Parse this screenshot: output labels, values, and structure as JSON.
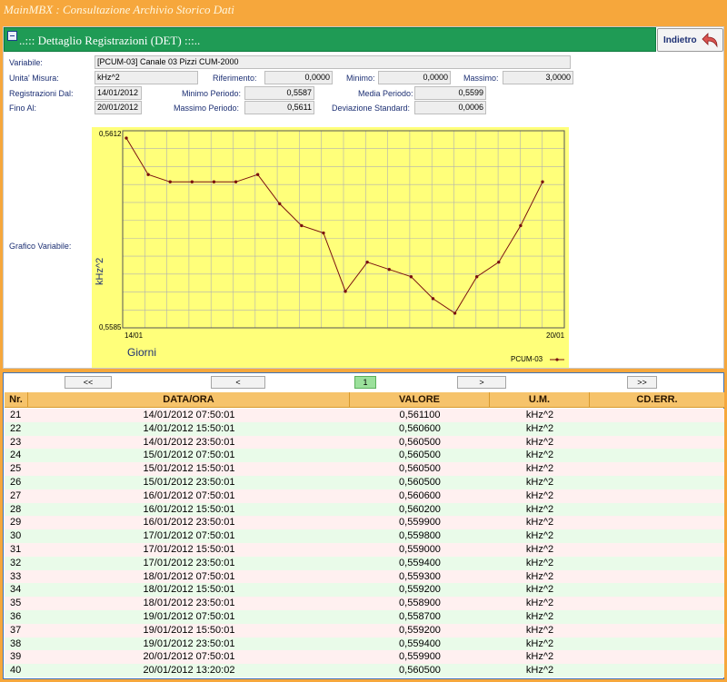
{
  "app": {
    "title": "MainMBX : Consultazione Archivio Storico Dati"
  },
  "panel": {
    "title": "..:::  Dettaglio Registrazioni (DET) :::..",
    "back_label": "Indietro"
  },
  "form": {
    "variabile_label": "Variabile:",
    "variabile_value": "[PCUM-03] Canale 03 Pizzi CUM-2000",
    "unita_label": "Unita' Misura:",
    "unita_value": "kHz^2",
    "riferimento_label": "Riferimento:",
    "riferimento_value": "0,0000",
    "minimo_label": "Minimo:",
    "minimo_value": "0,0000",
    "massimo_label": "Massimo:",
    "massimo_value": "3,0000",
    "reg_dal_label": "Registrazioni Dal:",
    "reg_dal_value": "14/01/2012",
    "min_periodo_label": "Minimo Periodo:",
    "min_periodo_value": "0,5587",
    "media_periodo_label": "Media Periodo:",
    "media_periodo_value": "0,5599",
    "fino_al_label": "Fino Al:",
    "fino_al_value": "20/01/2012",
    "max_periodo_label": "Massimo Periodo:",
    "max_periodo_value": "0,5611",
    "dev_std_label": "Deviazione Standard:",
    "dev_std_value": "0,0006",
    "grafico_label": "Grafico Variabile:"
  },
  "chart_data": {
    "type": "line",
    "title": "",
    "xlabel": "Giorni",
    "ylabel": "kHz^2",
    "ylim": [
      0.5585,
      0.5612
    ],
    "y_tick_labels": [
      "0,5612",
      "0,5585"
    ],
    "x_tick_labels": [
      "14/01",
      "20/01"
    ],
    "grid": true,
    "legend_position": "bottom-right",
    "colors": {
      "background": "#ffff7a",
      "grid": "#b0b0b0",
      "line": "#7a1010"
    },
    "series": [
      {
        "name": "PCUM-03",
        "values": [
          0.5611,
          0.5606,
          0.5605,
          0.5605,
          0.5605,
          0.5605,
          0.5606,
          0.5602,
          0.5599,
          0.5598,
          0.559,
          0.5594,
          0.5593,
          0.5592,
          0.5589,
          0.5587,
          0.5592,
          0.5594,
          0.5599,
          0.5605
        ]
      }
    ]
  },
  "pager": {
    "first": "<<",
    "prev": "<",
    "page": "1",
    "next": ">",
    "last": ">>"
  },
  "table": {
    "headers": [
      "Nr.",
      "DATA/ORA",
      "VALORE",
      "U.M.",
      "CD.ERR."
    ],
    "rows": [
      [
        "21",
        "14/01/2012 07:50:01",
        "0,561100",
        "kHz^2",
        ""
      ],
      [
        "22",
        "14/01/2012 15:50:01",
        "0,560600",
        "kHz^2",
        ""
      ],
      [
        "23",
        "14/01/2012 23:50:01",
        "0,560500",
        "kHz^2",
        ""
      ],
      [
        "24",
        "15/01/2012 07:50:01",
        "0,560500",
        "kHz^2",
        ""
      ],
      [
        "25",
        "15/01/2012 15:50:01",
        "0,560500",
        "kHz^2",
        ""
      ],
      [
        "26",
        "15/01/2012 23:50:01",
        "0,560500",
        "kHz^2",
        ""
      ],
      [
        "27",
        "16/01/2012 07:50:01",
        "0,560600",
        "kHz^2",
        ""
      ],
      [
        "28",
        "16/01/2012 15:50:01",
        "0,560200",
        "kHz^2",
        ""
      ],
      [
        "29",
        "16/01/2012 23:50:01",
        "0,559900",
        "kHz^2",
        ""
      ],
      [
        "30",
        "17/01/2012 07:50:01",
        "0,559800",
        "kHz^2",
        ""
      ],
      [
        "31",
        "17/01/2012 15:50:01",
        "0,559000",
        "kHz^2",
        ""
      ],
      [
        "32",
        "17/01/2012 23:50:01",
        "0,559400",
        "kHz^2",
        ""
      ],
      [
        "33",
        "18/01/2012 07:50:01",
        "0,559300",
        "kHz^2",
        ""
      ],
      [
        "34",
        "18/01/2012 15:50:01",
        "0,559200",
        "kHz^2",
        ""
      ],
      [
        "35",
        "18/01/2012 23:50:01",
        "0,558900",
        "kHz^2",
        ""
      ],
      [
        "36",
        "19/01/2012 07:50:01",
        "0,558700",
        "kHz^2",
        ""
      ],
      [
        "37",
        "19/01/2012 15:50:01",
        "0,559200",
        "kHz^2",
        ""
      ],
      [
        "38",
        "19/01/2012 23:50:01",
        "0,559400",
        "kHz^2",
        ""
      ],
      [
        "39",
        "20/01/2012 07:50:01",
        "0,559900",
        "kHz^2",
        ""
      ],
      [
        "40",
        "20/01/2012 13:20:02",
        "0,560500",
        "kHz^2",
        ""
      ]
    ]
  }
}
